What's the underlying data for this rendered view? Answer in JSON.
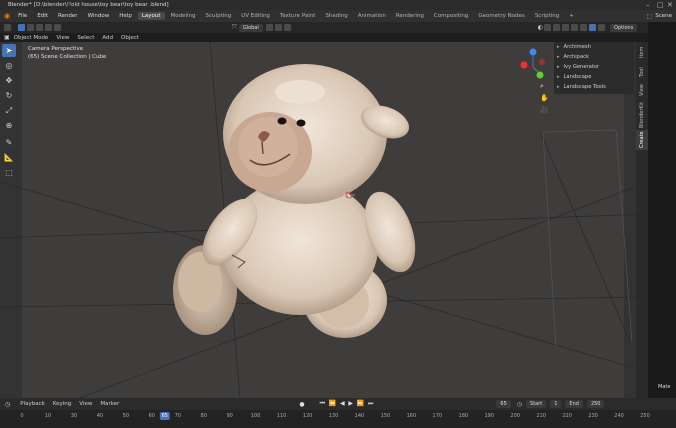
{
  "window": {
    "title": "Blender* [D:\\blender\\!!old house\\toy bear\\toy bear .blend]"
  },
  "menu": [
    "File",
    "Edit",
    "Render",
    "Window",
    "Help"
  ],
  "workspaces": [
    {
      "label": "Layout",
      "active": true
    },
    {
      "label": "Modeling",
      "active": false
    },
    {
      "label": "Sculpting",
      "active": false
    },
    {
      "label": "UV Editing",
      "active": false
    },
    {
      "label": "Texture Paint",
      "active": false
    },
    {
      "label": "Shading",
      "active": false
    },
    {
      "label": "Animation",
      "active": false
    },
    {
      "label": "Rendering",
      "active": false
    },
    {
      "label": "Compositing",
      "active": false
    },
    {
      "label": "Geometry Nodes",
      "active": false
    },
    {
      "label": "Scripting",
      "active": false
    }
  ],
  "workspace_add": "+",
  "scene_label": "Scene",
  "header": {
    "orientation": "Global",
    "options": "Options"
  },
  "mode_header": {
    "mode": "Object Mode",
    "items": [
      "View",
      "Select",
      "Add",
      "Object"
    ]
  },
  "viewport_info": {
    "line1": "Camera Perspective",
    "line2": "(65) Scene Collection | Cube"
  },
  "addons": [
    "Archimesh",
    "Archipack",
    "Ivy Generator",
    "Landscape",
    "Landscape Tools"
  ],
  "sidebar_tabs": [
    "Item",
    "Tool",
    "View",
    "BlenderKit",
    "Create"
  ],
  "sidebar_active": "Create",
  "status_right": "Mate",
  "timeline": {
    "items": [
      "Playback",
      "Keying",
      "View",
      "Marker"
    ],
    "current_frame": "65",
    "start_label": "Start",
    "start": "1",
    "end_label": "End",
    "end": "250",
    "ticks": [
      "0",
      "10",
      "30",
      "40",
      "50",
      "60",
      "70",
      "80",
      "90",
      "100",
      "110",
      "120",
      "130",
      "140",
      "150",
      "160",
      "170",
      "180",
      "190",
      "200",
      "210",
      "220",
      "230",
      "240",
      "250"
    ],
    "playhead": "65"
  },
  "colors": {
    "accent": "#4772b3",
    "viewport_bg": "#3d3d3d"
  }
}
